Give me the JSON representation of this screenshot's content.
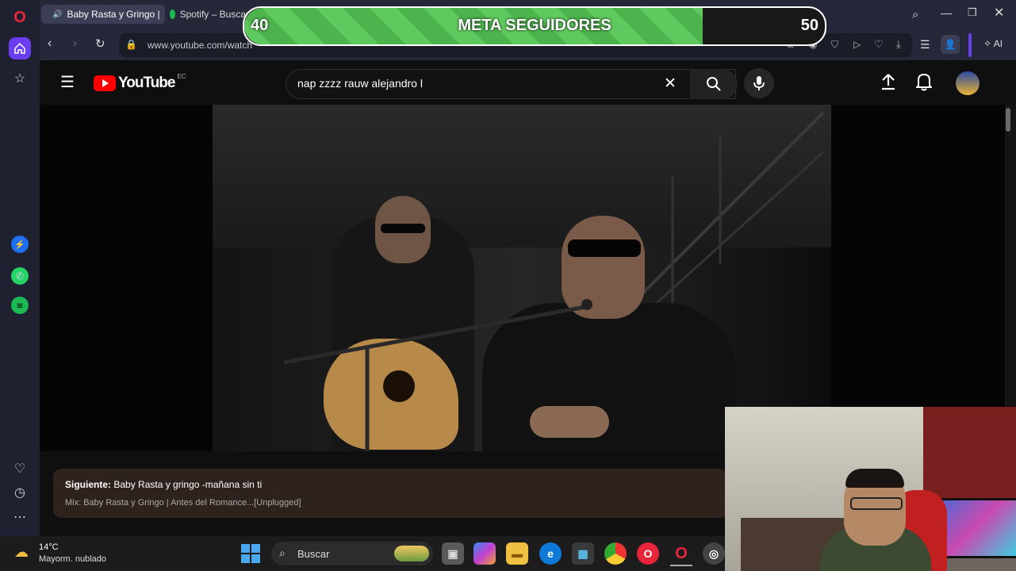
{
  "browser": {
    "tabs": [
      {
        "label": "Baby Rasta y Gringo |",
        "active": true
      },
      {
        "label": "Spotify – Buscar",
        "active": false
      }
    ],
    "url": "www.youtube.com/watch",
    "ai_label": "AI"
  },
  "goal_banner": {
    "start": "40",
    "title": "META SEGUIDORES",
    "end": "50",
    "progress_fraction": 0.79,
    "fill_color": "#5ec95e"
  },
  "youtube": {
    "logo_text": "YouTube",
    "country_code": "EC",
    "search_value": "nap zzzz rauw alejandro l",
    "up_next": {
      "label": "Siguiente:",
      "title": "Baby Rasta y gringo -mañana sin ti",
      "subtitle": "Mix: Baby Rasta y Gringo | Antes del Romance...[Unplugged]"
    }
  },
  "taskbar": {
    "weather_temp": "14°C",
    "weather_desc": "Mayorm. nublado",
    "search_placeholder": "Buscar"
  },
  "colors": {
    "accent_red": "#ff0000",
    "opera_red": "#e8253a",
    "sidebar_bg": "#1f2130"
  }
}
